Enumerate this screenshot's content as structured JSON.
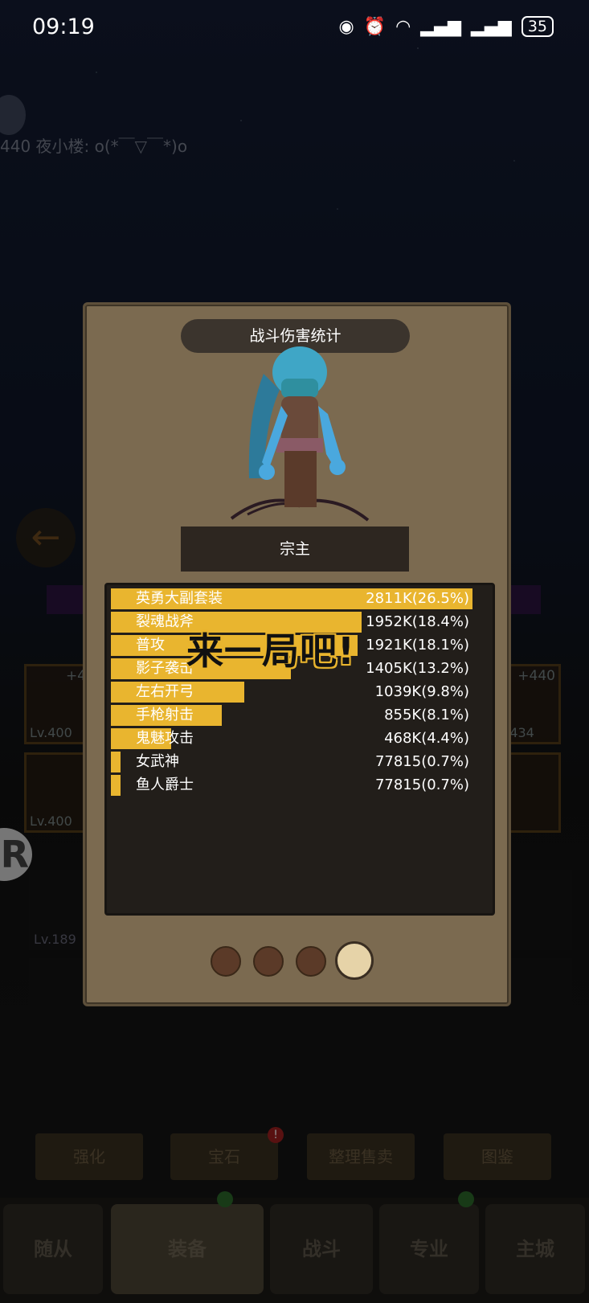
{
  "status_bar": {
    "time": "09:19",
    "icons": [
      "eye-icon",
      "alarm-icon",
      "wifi-icon",
      "signal-icon",
      "signal-icon"
    ],
    "battery": "35"
  },
  "background": {
    "chat_line": "440 夜小楼: o(*￣▽￣*)o",
    "slots_left": [
      {
        "plus": "+4",
        "level": "Lv.400"
      },
      {
        "plus": "",
        "level": "Lv.400"
      }
    ],
    "slots_right": [
      {
        "plus": "+440",
        "level": "v.434"
      },
      {
        "plus": "",
        "level": ""
      }
    ],
    "inventory_first_level": "Lv.189",
    "actions": [
      "强化",
      "宝石",
      "整理售卖",
      "图鉴"
    ],
    "tabs": [
      "随从",
      "装备",
      "战斗",
      "专业",
      "主城"
    ],
    "active_tab": "装备"
  },
  "modal": {
    "title": "战斗伤害统计",
    "character_name": "宗主",
    "overlay_text": "来一局吧!",
    "pages": 4,
    "active_page": 4
  },
  "chart_data": {
    "type": "bar",
    "orientation": "horizontal",
    "categories": [
      "英勇大副套装",
      "裂魂战斧",
      "普攻",
      "影子袭击",
      "左右开弓",
      "手枪射击",
      "鬼魅攻击",
      "女武神",
      "鱼人爵士"
    ],
    "labels": [
      "2811K(26.5%)",
      "1952K(18.4%)",
      "1921K(18.1%)",
      "1405K(13.2%)",
      "1039K(9.8%)",
      "855K(8.1%)",
      "468K(4.4%)",
      "77815(0.7%)",
      "77815(0.7%)"
    ],
    "percents": [
      26.5,
      18.4,
      18.1,
      13.2,
      9.8,
      8.1,
      4.4,
      0.7,
      0.7
    ],
    "color": "#e9b52f"
  }
}
